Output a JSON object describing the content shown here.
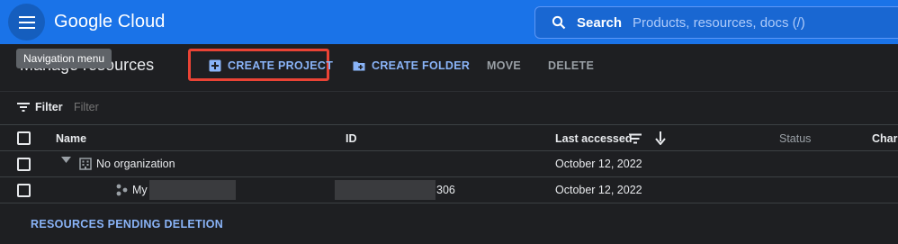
{
  "header": {
    "logo_google": "Google",
    "logo_cloud": "Cloud",
    "search_label": "Search",
    "search_placeholder": "Products, resources, docs (/)",
    "brand_color": "#1a73e8"
  },
  "tooltip": {
    "text": "Navigation menu"
  },
  "page": {
    "title": "Manage resources"
  },
  "actions": {
    "create_project": "CREATE PROJECT",
    "create_folder": "CREATE FOLDER",
    "move": "MOVE",
    "delete": "DELETE"
  },
  "filter": {
    "label": "Filter",
    "placeholder": "Filter"
  },
  "table": {
    "columns": {
      "name": "Name",
      "id": "ID",
      "last_accessed": "Last accessed",
      "status": "Status",
      "charges": "Charg"
    },
    "rows": [
      {
        "name": "No organization",
        "id": "",
        "last_accessed": "October 12, 2022",
        "icon": "organization-icon"
      },
      {
        "name": "My",
        "id_suffix": "306",
        "last_accessed": "October 12, 2022",
        "icon": "project-icon"
      }
    ]
  },
  "footer": {
    "pending_link": "RESOURCES PENDING DELETION"
  },
  "colors": {
    "highlight": "#ea4335",
    "link": "#8ab4f8"
  }
}
